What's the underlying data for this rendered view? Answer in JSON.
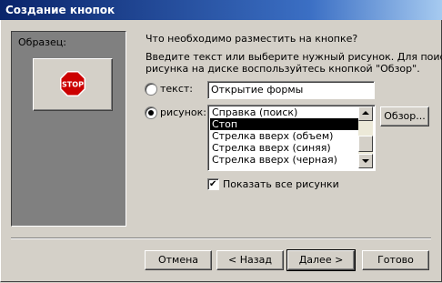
{
  "window": {
    "title": "Создание кнопок"
  },
  "preview": {
    "label": "Образец:",
    "button_icon": "stop-sign-icon",
    "sign_text": "STOP"
  },
  "prompt": {
    "question": "Что необходимо разместить на кнопке?",
    "instruction_line1": "Введите текст или выберите нужный рисунок.  Для поиска",
    "instruction_line2": "рисунка на диске воспользуйтесь кнопкой \"Обзор\"."
  },
  "options": {
    "text_label": "текст:",
    "text_value": "Открытие формы",
    "text_selected": false,
    "picture_label": "рисунок:",
    "picture_selected": true
  },
  "picture_list": {
    "items": [
      "Справка (поиск)",
      "Стоп",
      "Стрелка вверх (объем)",
      "Стрелка вверх (синяя)",
      "Стрелка вверх (черная)"
    ],
    "selected_index": 1
  },
  "browse_button": "Обзор...",
  "show_all": {
    "label": "Показать все рисунки",
    "checked": true
  },
  "footer": {
    "cancel": "Отмена",
    "back": "< Назад",
    "next": "Далее >",
    "finish": "Готово"
  },
  "colors": {
    "titlebar_start": "#0a246a",
    "titlebar_end": "#a6caf0",
    "stop_red": "#cc0000",
    "face": "#d4d0c8"
  }
}
